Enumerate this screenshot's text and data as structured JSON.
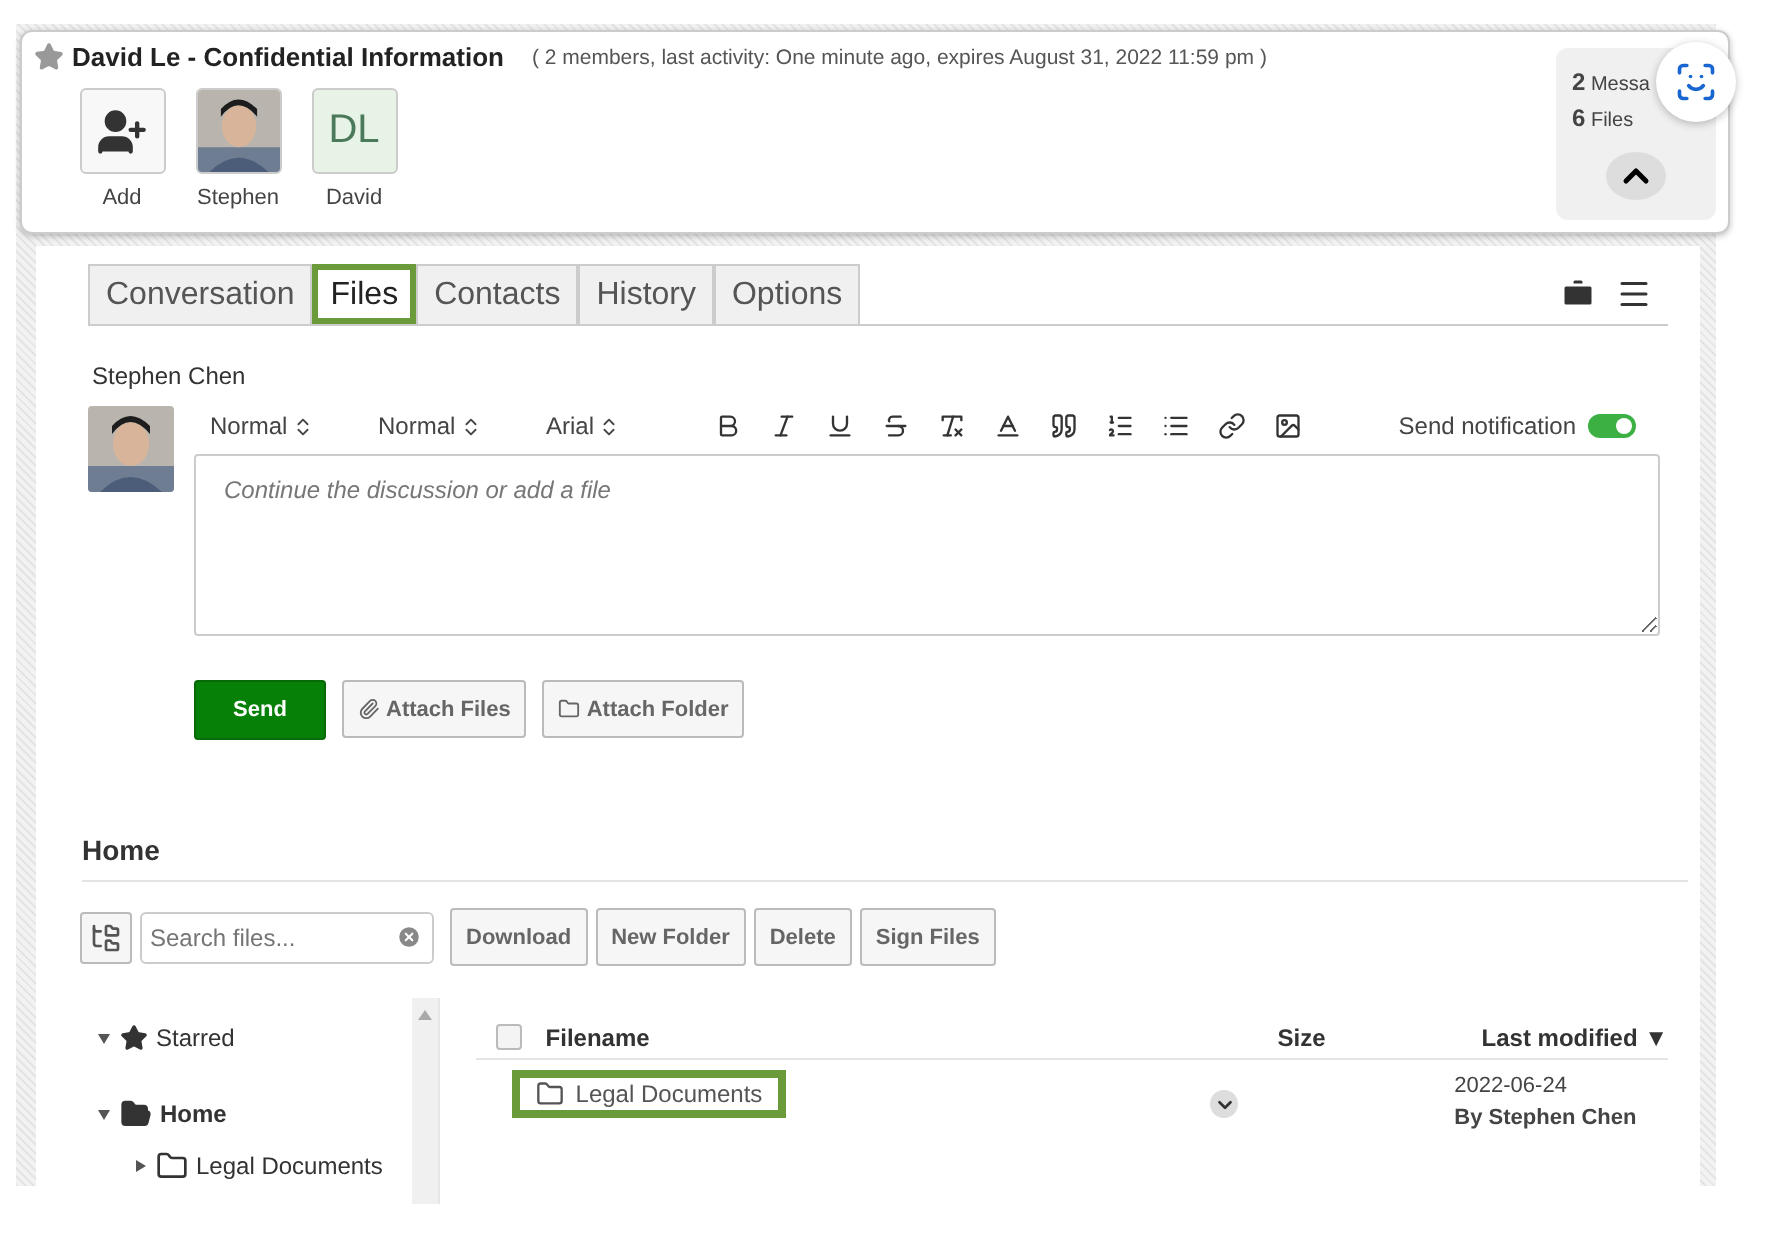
{
  "header": {
    "starred": false,
    "title": "David Le - Confidential Information",
    "meta": "( 2 members, last activity: One minute ago, expires August 31, 2022 11:59 pm )",
    "members": [
      {
        "kind": "add",
        "label": "Add"
      },
      {
        "label": "Stephen"
      },
      {
        "kind": "initials",
        "initials": "DL",
        "label": "David"
      }
    ],
    "stats": [
      {
        "count": "2",
        "label": "Messa"
      },
      {
        "count": "6",
        "label": "Files"
      }
    ]
  },
  "tabs": [
    {
      "label": "Conversation",
      "selected": false
    },
    {
      "label": "Files",
      "selected": true
    },
    {
      "label": "Contacts",
      "selected": false
    },
    {
      "label": "History",
      "selected": false
    },
    {
      "label": "Options",
      "selected": false
    }
  ],
  "composer": {
    "author": "Stephen Chen",
    "selects": [
      "Normal",
      "Normal",
      "Arial"
    ],
    "notify_label": "Send notification",
    "notify_on": true,
    "placeholder": "Continue the discussion or add a file",
    "send": "Send",
    "attach_files": "Attach Files",
    "attach_folder": "Attach Folder"
  },
  "files": {
    "heading": "Home",
    "search_placeholder": "Search files...",
    "actions": [
      "Download",
      "New Folder",
      "Delete",
      "Sign Files"
    ],
    "tree": [
      {
        "label": "Starred",
        "kind": "starred",
        "expanded": true,
        "selected": false
      },
      {
        "label": "Home",
        "kind": "folder",
        "expanded": true,
        "selected": true,
        "children": [
          {
            "label": "Legal Documents",
            "kind": "folder",
            "expanded": false,
            "selected": false
          }
        ]
      }
    ],
    "select_all": false,
    "columns": [
      "Filename",
      "Size",
      "Last modified ▼"
    ],
    "rows": [
      {
        "name": "Legal Documents",
        "highlighted": true,
        "date": "2022-06-24",
        "by": "By Stephen Chen"
      }
    ]
  }
}
